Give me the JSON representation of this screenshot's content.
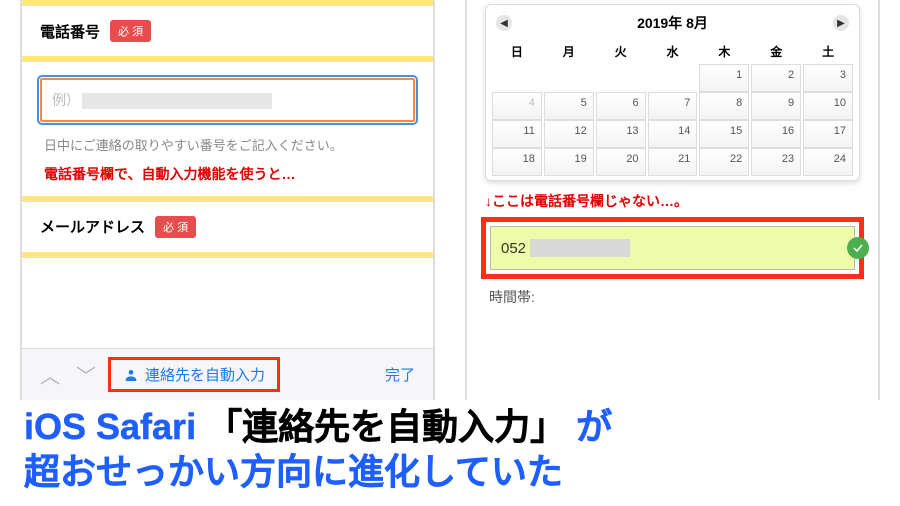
{
  "left": {
    "section1_label": "電話番号",
    "badge": "必 須",
    "phone_placeholder_prefix": "例）",
    "helper": "日中にご連絡の取りやすい番号をご記入ください。",
    "section2_label": "メールアドレス",
    "caption_red": "電話番号欄で、自動入力機能を使うと…"
  },
  "accessory": {
    "autofill": "連絡先を自動入力",
    "done": "完了"
  },
  "calendar": {
    "title": "2019年 8月",
    "weekdays": [
      "日",
      "月",
      "火",
      "水",
      "木",
      "金",
      "土"
    ],
    "rows": [
      [
        "",
        "",
        "",
        "",
        "1",
        "2",
        "3"
      ],
      [
        "4",
        "5",
        "6",
        "7",
        "8",
        "9",
        "10"
      ],
      [
        "11",
        "12",
        "13",
        "14",
        "15",
        "16",
        "17"
      ],
      [
        "18",
        "19",
        "20",
        "21",
        "22",
        "23",
        "24"
      ]
    ]
  },
  "right": {
    "caption_red": "↓ここは電話番号欄じゃない…。",
    "auto_value": "052",
    "time_label": "時間帯:"
  },
  "headline": {
    "t1": "iOS Safari",
    "t2": "「連絡先を自動入力」",
    "t3": "が",
    "t4": "超おせっかい方向に進化していた"
  }
}
